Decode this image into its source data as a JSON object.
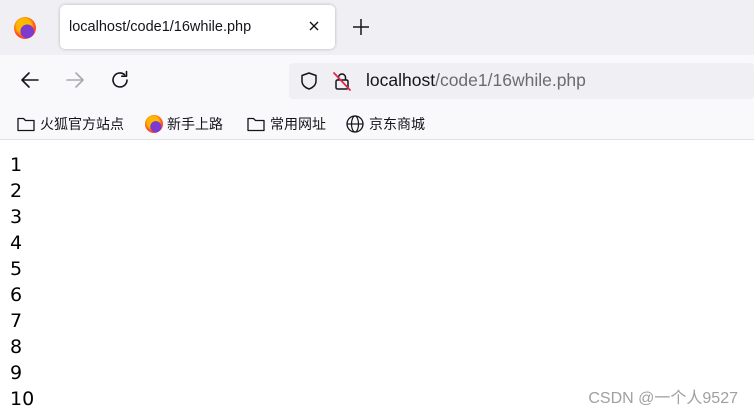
{
  "tabs": [
    {
      "title": "localhost/code1/16while.php",
      "active": true
    }
  ],
  "icons": {
    "tab_favicon": "firefox-icon",
    "tab_close": "close-icon",
    "new_tab": "plus-icon",
    "back": "arrow-left-icon",
    "forward": "arrow-right-icon",
    "reload": "reload-icon",
    "tracking": "shield-icon",
    "insecure": "lock-insecure-icon"
  },
  "urlbar": {
    "host": "localhost",
    "path": "/code1/16while.php"
  },
  "bookmarks": [
    {
      "label": "火狐官方站点",
      "icon": "folder-icon"
    },
    {
      "label": "新手上路",
      "icon": "firefox-icon"
    },
    {
      "label": "常用网址",
      "icon": "folder-icon"
    },
    {
      "label": "京东商城",
      "icon": "globe-icon"
    }
  ],
  "page": {
    "lines": [
      "1",
      "2",
      "3",
      "4",
      "5",
      "6",
      "7",
      "8",
      "9",
      "10"
    ]
  },
  "watermark": "CSDN @一个人9527",
  "colors": {
    "tabstrip_bg": "#f0f0f4",
    "toolbar_bg": "#f9f9fb",
    "urlbar_bg": "#f0f0f4",
    "insecure_red": "#e22850"
  }
}
